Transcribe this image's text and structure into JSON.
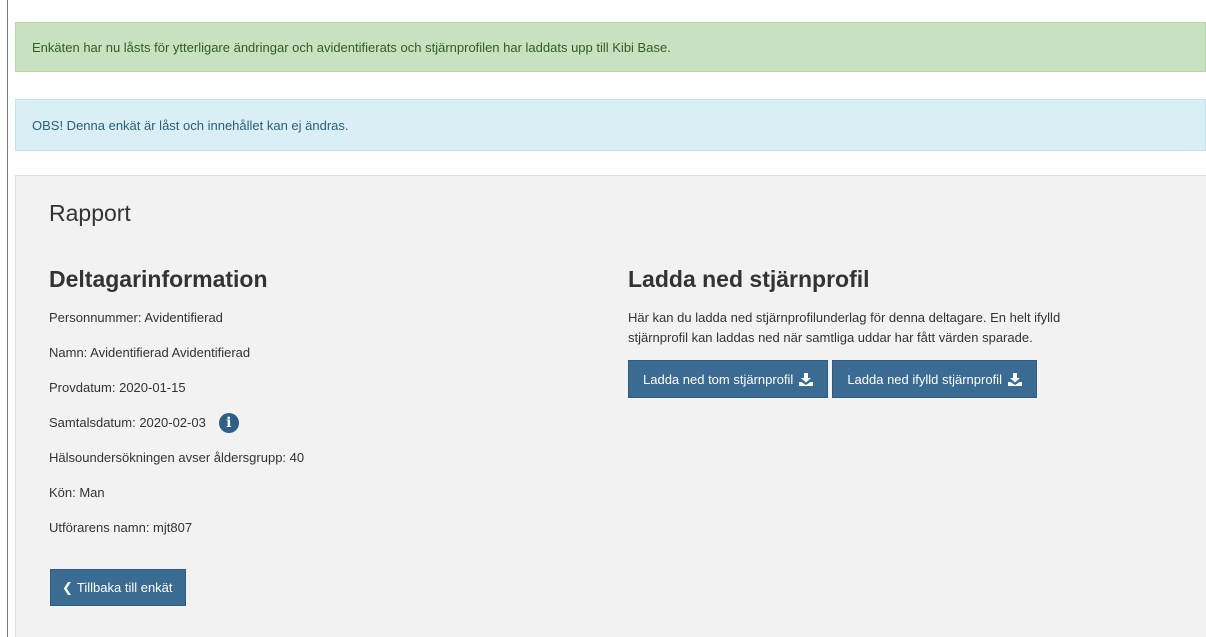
{
  "alerts": {
    "success": "Enkäten har nu låsts för ytterligare ändringar och avidentifierats och stjärnprofilen har laddats upp till Kibi Base.",
    "info": "OBS! Denna enkät är låst och innehållet kan ej ändras."
  },
  "panel": {
    "title": "Rapport"
  },
  "participant": {
    "heading": "Deltagarinformation",
    "personnummer": "Personnummer: Avidentifierad",
    "namn": "Namn: Avidentifierad Avidentifierad",
    "provdatum": "Provdatum: 2020-01-15",
    "samtalsdatum": "Samtalsdatum: 2020-02-03",
    "aldersgrupp": "Hälsoundersökningen avser åldersgrupp: 40",
    "kon": "Kön: Man",
    "utforare": "Utförarens namn: mjt807",
    "back_button": "Tillbaka till enkät",
    "icons": {
      "info": "info-circle-icon",
      "back": "chevron-left-icon"
    }
  },
  "download": {
    "heading": "Ladda ned stjärnprofil",
    "line1": "Här kan du ladda ned stjärnprofilunderlag för denna deltagare. En helt ifylld",
    "line2": "stjärnprofil kan laddas ned när samtliga uddar har fått värden sparade.",
    "empty_button": "Ladda ned tom stjärnprofil",
    "filled_button": "Ladda ned ifylld stjärnprofil",
    "icon": "download-icon"
  },
  "colors": {
    "success_bg": "#c8e1c0",
    "info_bg": "#daeef5",
    "button": "#3a6b92"
  }
}
